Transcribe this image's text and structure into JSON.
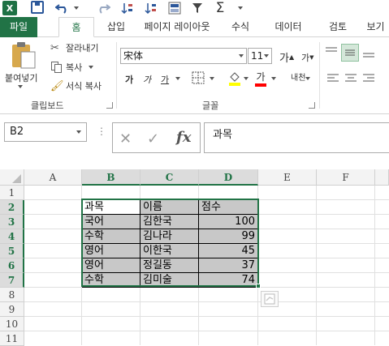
{
  "quick_access": {
    "logo": "X",
    "icons": [
      "excel-logo-icon",
      "save-icon",
      "undo-icon",
      "redo-icon",
      "sort-ascending-icon",
      "sort-descending-icon",
      "form-icon",
      "filter-icon",
      "autosum-icon",
      "customize-icon"
    ]
  },
  "tabs": [
    "파일",
    "홈",
    "삽입",
    "페이지 레이아웃",
    "수식",
    "데이터",
    "검토",
    "보기"
  ],
  "clipboard": {
    "paste_label": "붙여넣기",
    "cut_label": "잘라내기",
    "copy_label": "복사",
    "format_painter_label": "서식 복사",
    "group_label": "클립보드"
  },
  "font": {
    "name": "宋体",
    "size": "11",
    "grow_label": "가",
    "shrink_label": "가",
    "bold_label": "가",
    "italic_label": "가",
    "underline_label": "가",
    "text_color_label": "가",
    "phonetic_label": "내천",
    "group_label": "글꼴"
  },
  "formula_bar": {
    "name_box": "B2",
    "fx_label": "fx",
    "content": "과목"
  },
  "columns": [
    "A",
    "B",
    "C",
    "D",
    "E",
    "F"
  ],
  "rows": [
    "1",
    "2",
    "3",
    "4",
    "5",
    "6",
    "7",
    "8",
    "9",
    "10",
    "11"
  ],
  "table": {
    "headers": [
      "과목",
      "이름",
      "점수"
    ],
    "rows": [
      [
        "국어",
        "김한국",
        "100"
      ],
      [
        "수학",
        "김나라",
        "99"
      ],
      [
        "영어",
        "이한국",
        "45"
      ],
      [
        "영어",
        "정길동",
        "37"
      ],
      [
        "수학",
        "김미술",
        "74"
      ]
    ]
  },
  "colors": {
    "accent": "#217346",
    "cell_fill": "#c8c8c8"
  }
}
